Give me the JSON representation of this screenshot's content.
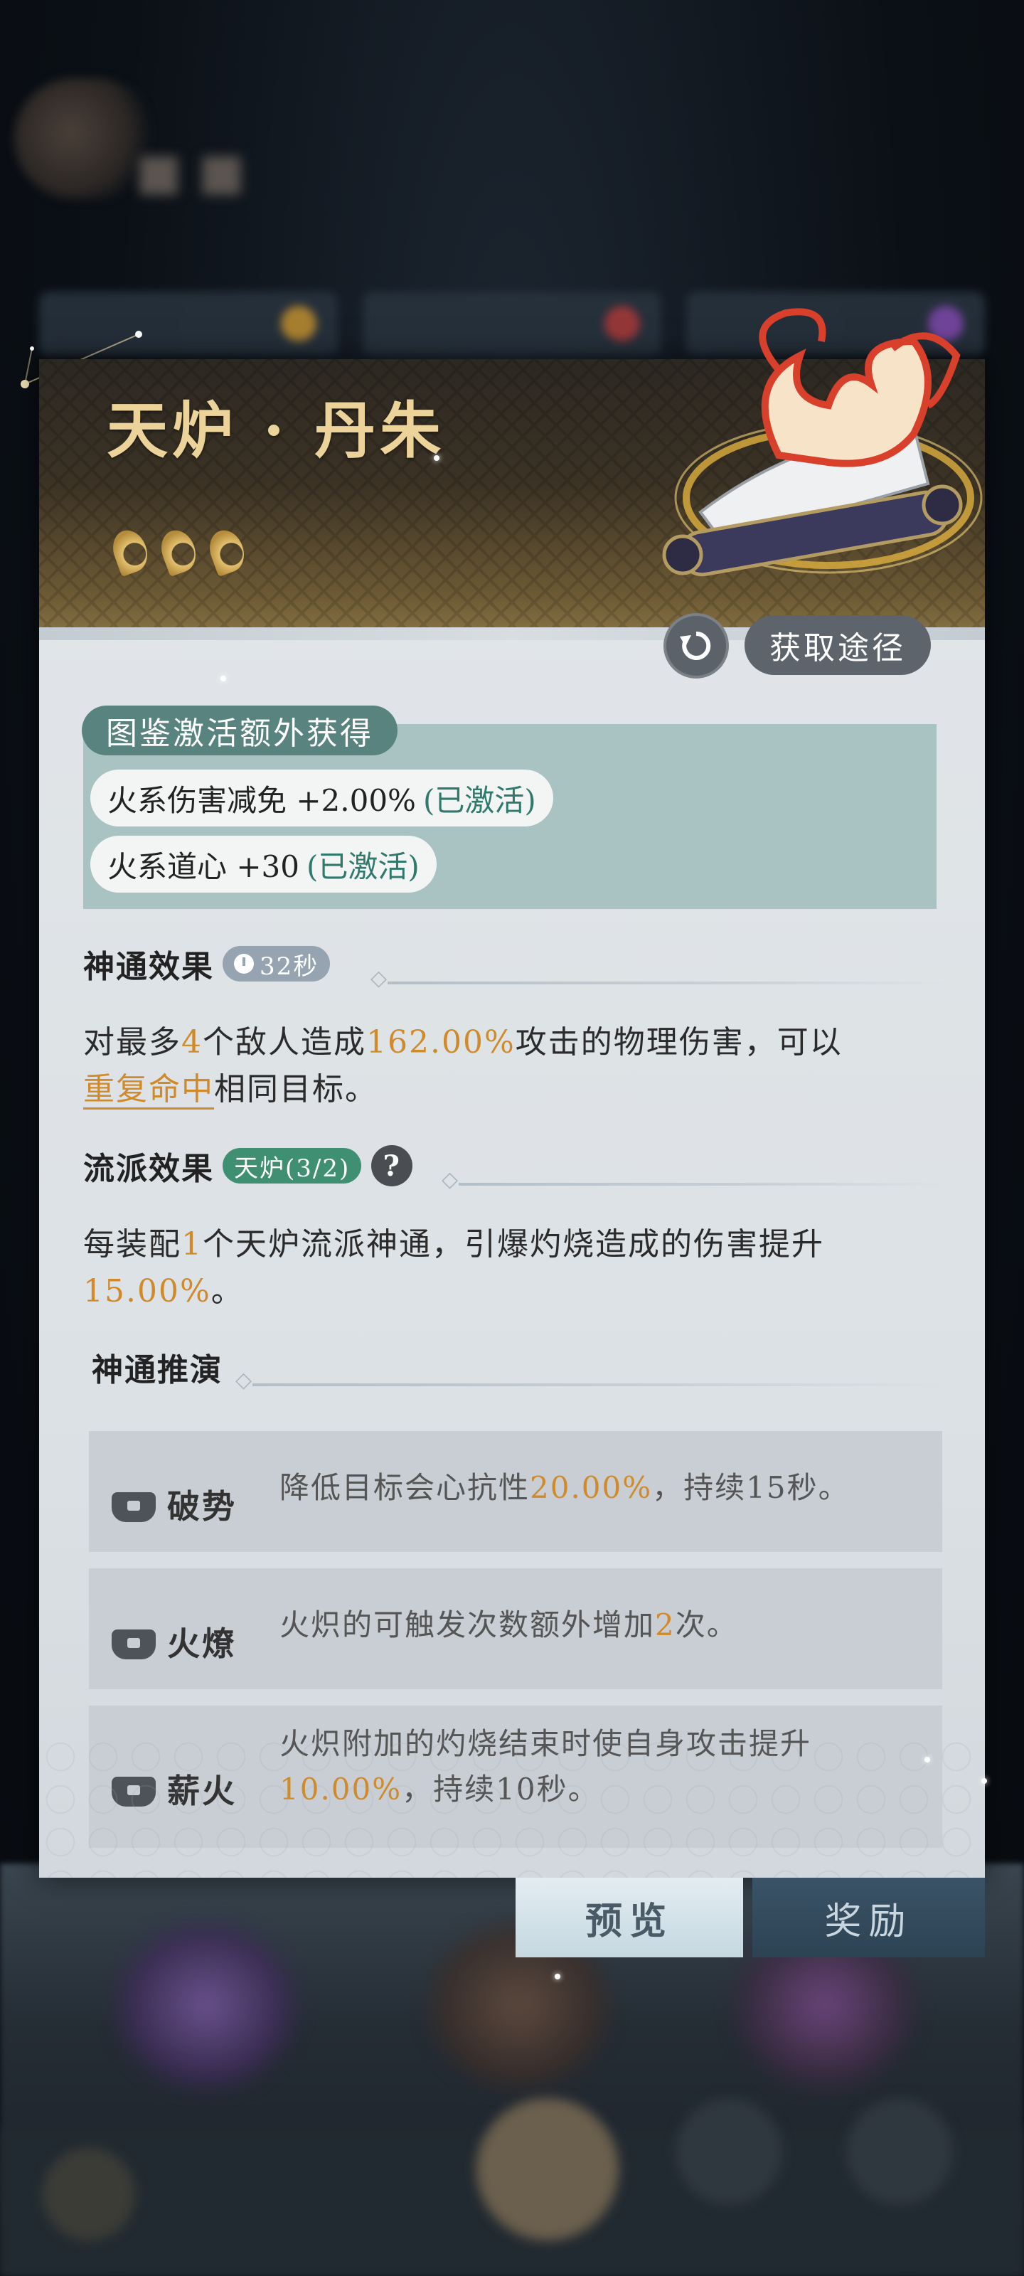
{
  "item": {
    "title": "天炉 · 丹朱",
    "quality_level": 3
  },
  "actions": {
    "refresh_icon": "refresh-icon",
    "obtain_label": "获取途径"
  },
  "activation": {
    "tag": "图鉴激活额外获得",
    "rows": [
      {
        "text": "火系伤害减免 +2.00%",
        "status": "(已激活)"
      },
      {
        "text": "火系道心 +30",
        "status": "(已激活)"
      }
    ]
  },
  "skill": {
    "title": "神通效果",
    "cooldown": "32秒",
    "desc_p1": "对最多",
    "desc_n1": "4",
    "desc_p2": "个敌人造成",
    "desc_n2": "162.00%",
    "desc_p3": "攻击的物理伤害，可以",
    "desc_link": "重复命中",
    "desc_p4": "相同目标。"
  },
  "school": {
    "title": "流派效果",
    "tag": "天炉(3/2)",
    "help": "?",
    "desc_p1": "每装配",
    "desc_n1": "1",
    "desc_p2": "个天炉流派神通，引爆灼烧造成的伤害提升",
    "desc_n2": "15.00%",
    "desc_p3": "。"
  },
  "evolution": {
    "title": "神通推演",
    "items": [
      {
        "name": "破势",
        "p1": "降低目标会心抗性",
        "n1": "20.00%",
        "p2": "，持续15秒。"
      },
      {
        "name": "火燎",
        "p1": "火炽的可触发次数额外增加",
        "n1": "2",
        "p2": "次。"
      },
      {
        "name": "薪火",
        "p1": "火炽附加的灼烧结束时使自身攻击提升",
        "n1": "10.00%",
        "p2": "，持续10秒。"
      }
    ]
  },
  "tabs": {
    "preview": "预览",
    "reward": "奖励"
  },
  "colors": {
    "highlight": "#d08a2a",
    "activated": "#2f7a6c",
    "title_gold": "#ecd39a"
  }
}
